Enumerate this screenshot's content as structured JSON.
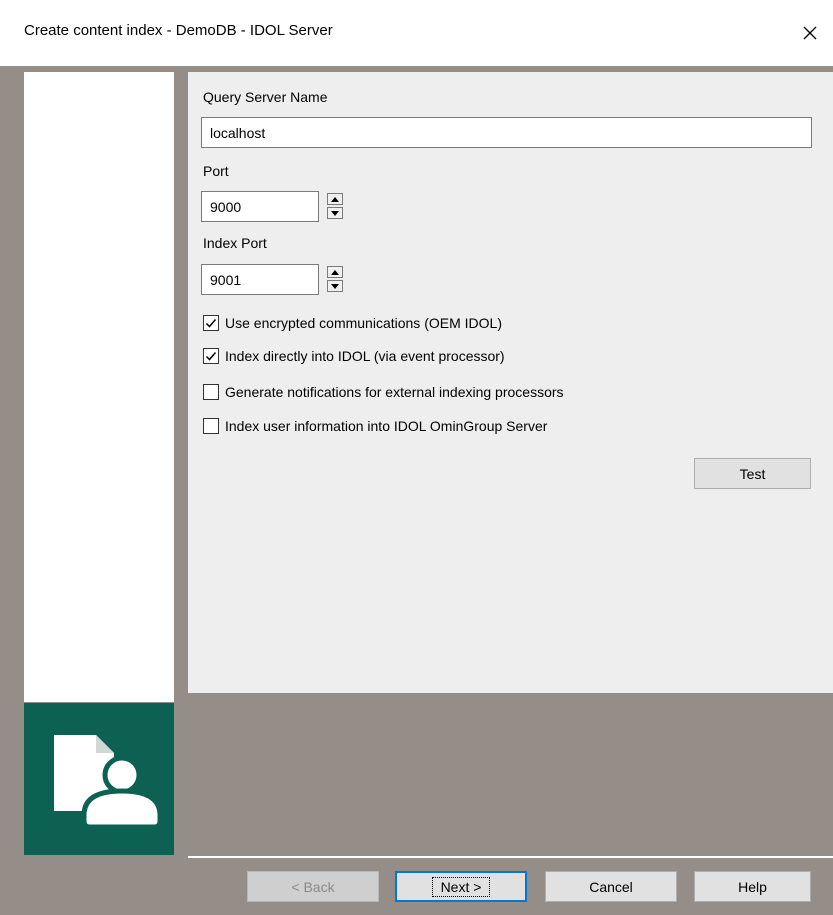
{
  "window": {
    "title": "Create content index - DemoDB - IDOL Server",
    "close_icon": "close-icon"
  },
  "form": {
    "query_server_label": "Query Server Name",
    "query_server_value": "localhost",
    "port_label": "Port",
    "port_value": "9000",
    "index_port_label": "Index Port",
    "index_port_value": "9001",
    "checkboxes": [
      {
        "label": "Use encrypted communications (OEM IDOL)",
        "checked": true
      },
      {
        "label": "Index directly into IDOL (via event processor)",
        "checked": true
      },
      {
        "label": "Generate notifications for external indexing processors",
        "checked": false
      },
      {
        "label": "Index user information into IDOL OminGroup Server",
        "checked": false
      }
    ],
    "test_label": "Test"
  },
  "footer": {
    "back_label": "< Back",
    "next_label": "Next >",
    "cancel_label": "Cancel",
    "help_label": "Help"
  },
  "colors": {
    "logo_bg": "#0d6152",
    "chrome": "#958d87",
    "panel": "#eeeeee"
  }
}
